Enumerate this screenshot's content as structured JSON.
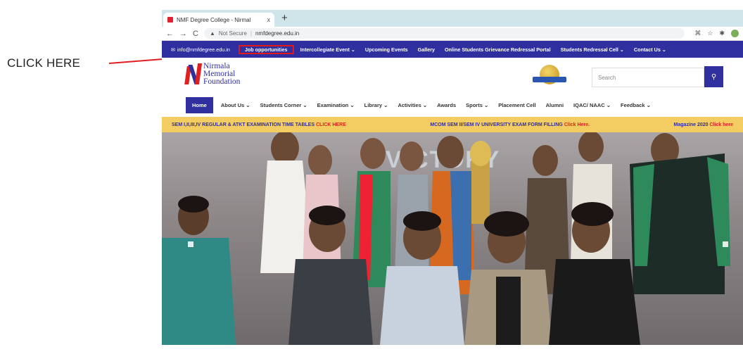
{
  "annotation": {
    "label": "CLICK HERE"
  },
  "browser": {
    "tab_title": "NMF Degree College - Nirmal",
    "tab_close": "x",
    "new_tab": "+",
    "back": "←",
    "forward": "→",
    "reload": "C",
    "security_label": "Not Secure",
    "url": "nmfdegree.edu.in",
    "icons": [
      "translate-icon",
      "star-icon",
      "extensions-icon",
      "profile-icon"
    ]
  },
  "topnav": {
    "email": "info@nmfdegree.edu.in",
    "items": [
      "Job opportunities",
      "Intercollegiate Event ⌄",
      "Upcoming Events",
      "Gallery",
      "Online Students Grievance Redressal Portal",
      "Students Redressal Cell ⌄",
      "Contact Us ⌄"
    ]
  },
  "header": {
    "logo_line1": "Nirmala",
    "logo_line2": "Memorial",
    "logo_line3": "Foundation",
    "search_placeholder": "Search",
    "search_icon": "⚲"
  },
  "mainnav": {
    "home": "Home",
    "items": [
      "About Us ⌄",
      "Students Corner ⌄",
      "Examination ⌄",
      "Library ⌄",
      "Activities ⌄",
      "Awards",
      "Sports ⌄",
      "Placement Cell",
      "Alumni",
      "IQAC/ NAAC ⌄",
      "Feedback ⌄"
    ]
  },
  "ticker": {
    "item1_text": "SEM I,II,III,IV REGULAR & ATKT EXAMINATION TIME TABLES",
    "item1_link": "CLICK HERE",
    "item2_text": "MCOM SEM II/SEM IV UNIVERSITY EXAM FORM FILLING",
    "item2_link": "Click Here.",
    "item3_text": "Magazine 2020",
    "item3_link": "Click here"
  },
  "hero": {
    "banner_text": "VICTORY"
  },
  "colors": {
    "brand_blue": "#2f2fa0",
    "accent_red": "#e02020",
    "ticker_yellow": "#f3cc62"
  }
}
